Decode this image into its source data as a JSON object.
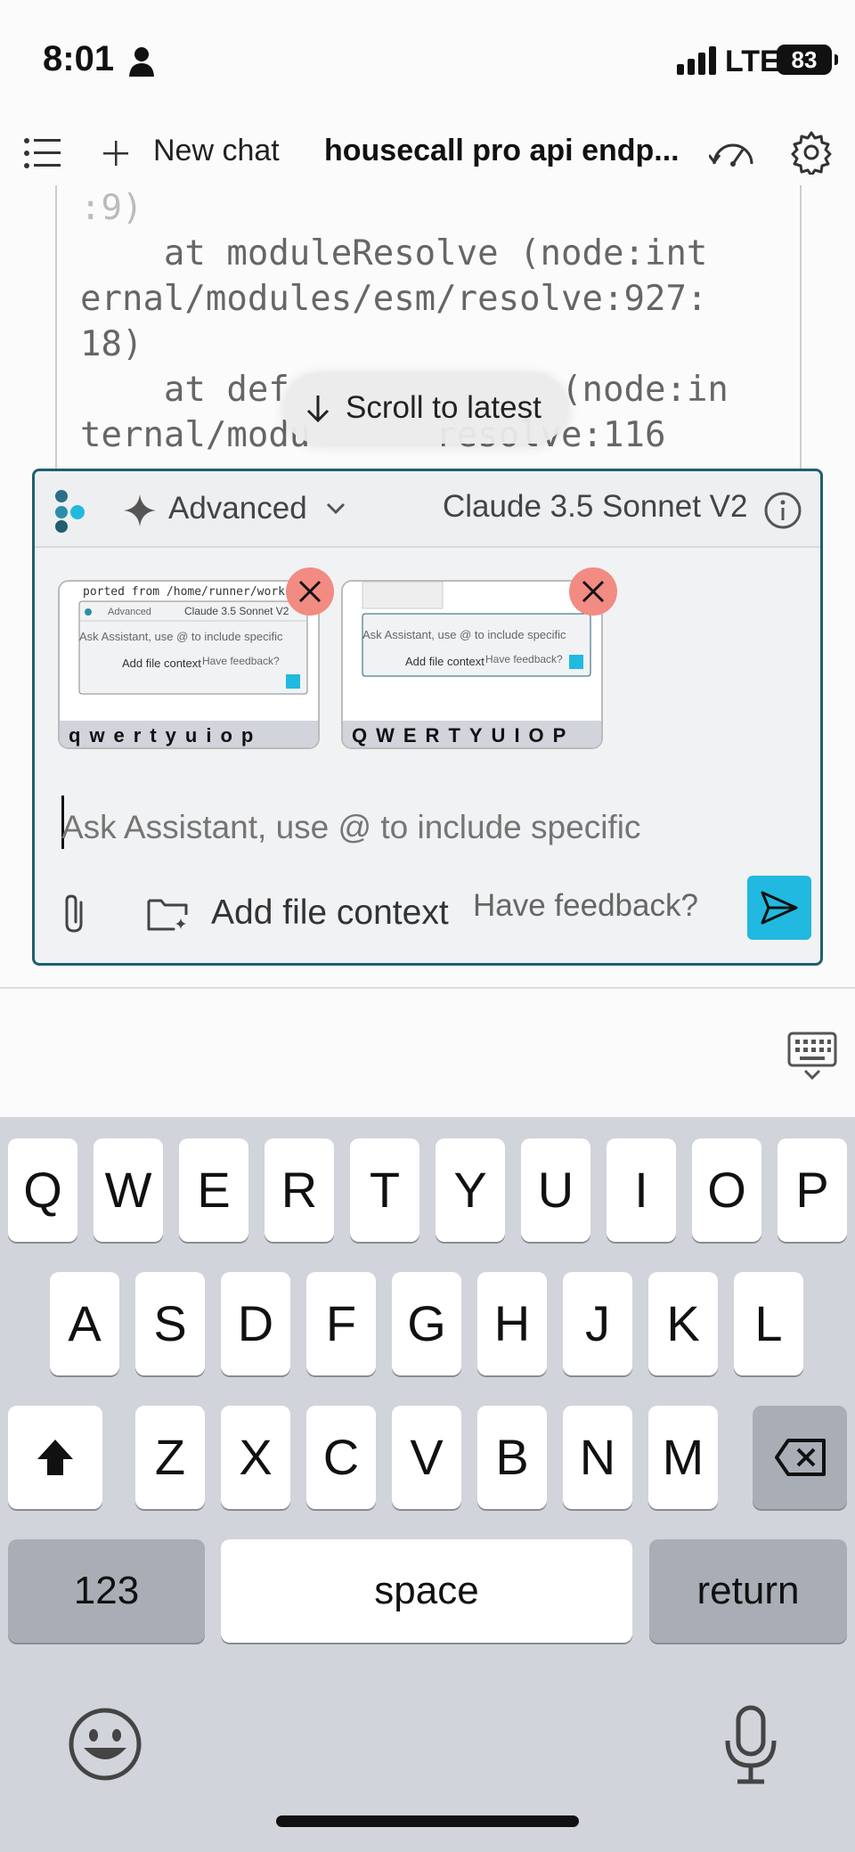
{
  "status_bar": {
    "time": "8:01",
    "network": "LTE",
    "battery": "83"
  },
  "toolbar": {
    "new_chat_label": "New chat",
    "title": "housecall pro api endp..."
  },
  "code_lines": [
    ":9)",
    "    at moduleResolve (node:int",
    "ernal/modules/esm/resolve:927:",
    "18)",
    "    at def",
    "ternal/modu"
  ],
  "code_hidden_tail": {
    "line5_end": "(node:in",
    "line6_end": "resolve:116"
  },
  "scroll_button": {
    "label": "Scroll to latest"
  },
  "composer": {
    "mode_label": "Advanced",
    "model_label": "Claude 3.5 Sonnet V2",
    "placeholder": "Ask Assistant, use @ to include specific",
    "add_file_context_label": "Add file context",
    "feedback_label": "Have feedback?",
    "attachments": [
      {
        "top_text": "ported from /home/runner/works",
        "mode": "Advanced",
        "model": "Claude 3.5 Sonnet V2",
        "placeholder": "Ask Assistant, use @ to include specific",
        "file_context": "Add file context",
        "feedback": "Have feedback?",
        "keys": "qwertyuiop"
      },
      {
        "top_text": "",
        "placeholder": "Ask Assistant, use @ to include specific",
        "file_context": "Add file context",
        "feedback": "Have feedback?",
        "keys": "QWERTYUIOP"
      }
    ]
  },
  "keyboard": {
    "row1": [
      "Q",
      "W",
      "E",
      "R",
      "T",
      "Y",
      "U",
      "I",
      "O",
      "P"
    ],
    "row2": [
      "A",
      "S",
      "D",
      "F",
      "G",
      "H",
      "J",
      "K",
      "L"
    ],
    "row3": [
      "Z",
      "X",
      "C",
      "V",
      "B",
      "N",
      "M"
    ],
    "numbers_key": "123",
    "space_key": "space",
    "return_key": "return"
  },
  "colors": {
    "accent": "#21b9df",
    "composer_border": "#1f5f6e",
    "remove_button": "#f28b82",
    "keyboard_bg": "#d1d4da"
  }
}
